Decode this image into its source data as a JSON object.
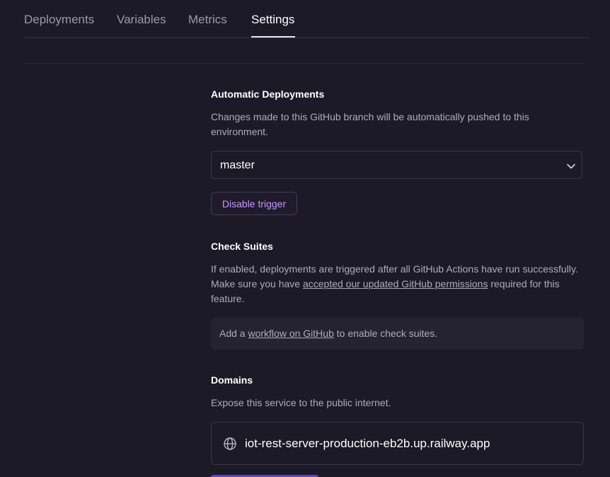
{
  "tabs": [
    {
      "label": "Deployments"
    },
    {
      "label": "Variables"
    },
    {
      "label": "Metrics"
    },
    {
      "label": "Settings"
    }
  ],
  "active_tab": "Settings",
  "auto_deploy": {
    "title": "Automatic Deployments",
    "description": "Changes made to this GitHub branch will be automatically pushed to this environment.",
    "branch_value": "master",
    "disable_button": "Disable trigger"
  },
  "check_suites": {
    "title": "Check Suites",
    "desc_part1": "If enabled, deployments are triggered after all GitHub Actions have run successfully. Make sure you have ",
    "desc_link": "accepted our updated GitHub permissions",
    "desc_part2": " required for this feature.",
    "note_part1": "Add a ",
    "note_link": "workflow on GitHub",
    "note_part2": " to enable check suites."
  },
  "domains": {
    "title": "Domains",
    "description": "Expose this service to the public internet.",
    "domain": "iot-rest-server-production-eb2b.up.railway.app"
  },
  "colors": {
    "background": "#1c1a26",
    "accent": "#c896ff",
    "primary_button": "#6b3ad6"
  },
  "icons": {
    "branch_select": "chevron-down-icon",
    "domain": "globe-icon"
  }
}
